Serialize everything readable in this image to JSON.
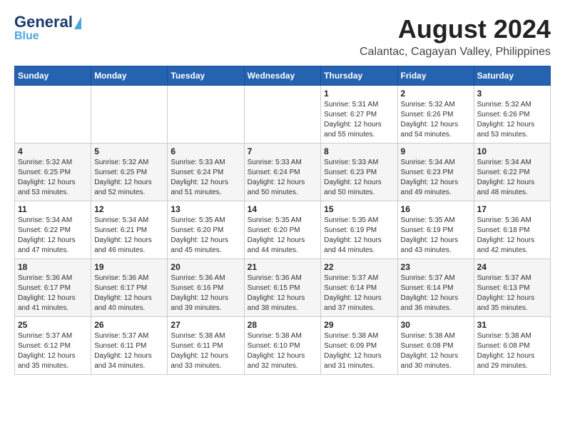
{
  "header": {
    "logo_general": "General",
    "logo_blue": "Blue",
    "title": "August 2024",
    "subtitle": "Calantac, Cagayan Valley, Philippines"
  },
  "calendar": {
    "days_of_week": [
      "Sunday",
      "Monday",
      "Tuesday",
      "Wednesday",
      "Thursday",
      "Friday",
      "Saturday"
    ],
    "weeks": [
      [
        {
          "day": "",
          "info": ""
        },
        {
          "day": "",
          "info": ""
        },
        {
          "day": "",
          "info": ""
        },
        {
          "day": "",
          "info": ""
        },
        {
          "day": "1",
          "info": "Sunrise: 5:31 AM\nSunset: 6:27 PM\nDaylight: 12 hours\nand 55 minutes."
        },
        {
          "day": "2",
          "info": "Sunrise: 5:32 AM\nSunset: 6:26 PM\nDaylight: 12 hours\nand 54 minutes."
        },
        {
          "day": "3",
          "info": "Sunrise: 5:32 AM\nSunset: 6:26 PM\nDaylight: 12 hours\nand 53 minutes."
        }
      ],
      [
        {
          "day": "4",
          "info": "Sunrise: 5:32 AM\nSunset: 6:25 PM\nDaylight: 12 hours\nand 53 minutes."
        },
        {
          "day": "5",
          "info": "Sunrise: 5:32 AM\nSunset: 6:25 PM\nDaylight: 12 hours\nand 52 minutes."
        },
        {
          "day": "6",
          "info": "Sunrise: 5:33 AM\nSunset: 6:24 PM\nDaylight: 12 hours\nand 51 minutes."
        },
        {
          "day": "7",
          "info": "Sunrise: 5:33 AM\nSunset: 6:24 PM\nDaylight: 12 hours\nand 50 minutes."
        },
        {
          "day": "8",
          "info": "Sunrise: 5:33 AM\nSunset: 6:23 PM\nDaylight: 12 hours\nand 50 minutes."
        },
        {
          "day": "9",
          "info": "Sunrise: 5:34 AM\nSunset: 6:23 PM\nDaylight: 12 hours\nand 49 minutes."
        },
        {
          "day": "10",
          "info": "Sunrise: 5:34 AM\nSunset: 6:22 PM\nDaylight: 12 hours\nand 48 minutes."
        }
      ],
      [
        {
          "day": "11",
          "info": "Sunrise: 5:34 AM\nSunset: 6:22 PM\nDaylight: 12 hours\nand 47 minutes."
        },
        {
          "day": "12",
          "info": "Sunrise: 5:34 AM\nSunset: 6:21 PM\nDaylight: 12 hours\nand 46 minutes."
        },
        {
          "day": "13",
          "info": "Sunrise: 5:35 AM\nSunset: 6:20 PM\nDaylight: 12 hours\nand 45 minutes."
        },
        {
          "day": "14",
          "info": "Sunrise: 5:35 AM\nSunset: 6:20 PM\nDaylight: 12 hours\nand 44 minutes."
        },
        {
          "day": "15",
          "info": "Sunrise: 5:35 AM\nSunset: 6:19 PM\nDaylight: 12 hours\nand 44 minutes."
        },
        {
          "day": "16",
          "info": "Sunrise: 5:35 AM\nSunset: 6:19 PM\nDaylight: 12 hours\nand 43 minutes."
        },
        {
          "day": "17",
          "info": "Sunrise: 5:36 AM\nSunset: 6:18 PM\nDaylight: 12 hours\nand 42 minutes."
        }
      ],
      [
        {
          "day": "18",
          "info": "Sunrise: 5:36 AM\nSunset: 6:17 PM\nDaylight: 12 hours\nand 41 minutes."
        },
        {
          "day": "19",
          "info": "Sunrise: 5:36 AM\nSunset: 6:17 PM\nDaylight: 12 hours\nand 40 minutes."
        },
        {
          "day": "20",
          "info": "Sunrise: 5:36 AM\nSunset: 6:16 PM\nDaylight: 12 hours\nand 39 minutes."
        },
        {
          "day": "21",
          "info": "Sunrise: 5:36 AM\nSunset: 6:15 PM\nDaylight: 12 hours\nand 38 minutes."
        },
        {
          "day": "22",
          "info": "Sunrise: 5:37 AM\nSunset: 6:14 PM\nDaylight: 12 hours\nand 37 minutes."
        },
        {
          "day": "23",
          "info": "Sunrise: 5:37 AM\nSunset: 6:14 PM\nDaylight: 12 hours\nand 36 minutes."
        },
        {
          "day": "24",
          "info": "Sunrise: 5:37 AM\nSunset: 6:13 PM\nDaylight: 12 hours\nand 35 minutes."
        }
      ],
      [
        {
          "day": "25",
          "info": "Sunrise: 5:37 AM\nSunset: 6:12 PM\nDaylight: 12 hours\nand 35 minutes."
        },
        {
          "day": "26",
          "info": "Sunrise: 5:37 AM\nSunset: 6:11 PM\nDaylight: 12 hours\nand 34 minutes."
        },
        {
          "day": "27",
          "info": "Sunrise: 5:38 AM\nSunset: 6:11 PM\nDaylight: 12 hours\nand 33 minutes."
        },
        {
          "day": "28",
          "info": "Sunrise: 5:38 AM\nSunset: 6:10 PM\nDaylight: 12 hours\nand 32 minutes."
        },
        {
          "day": "29",
          "info": "Sunrise: 5:38 AM\nSunset: 6:09 PM\nDaylight: 12 hours\nand 31 minutes."
        },
        {
          "day": "30",
          "info": "Sunrise: 5:38 AM\nSunset: 6:08 PM\nDaylight: 12 hours\nand 30 minutes."
        },
        {
          "day": "31",
          "info": "Sunrise: 5:38 AM\nSunset: 6:08 PM\nDaylight: 12 hours\nand 29 minutes."
        }
      ]
    ]
  }
}
